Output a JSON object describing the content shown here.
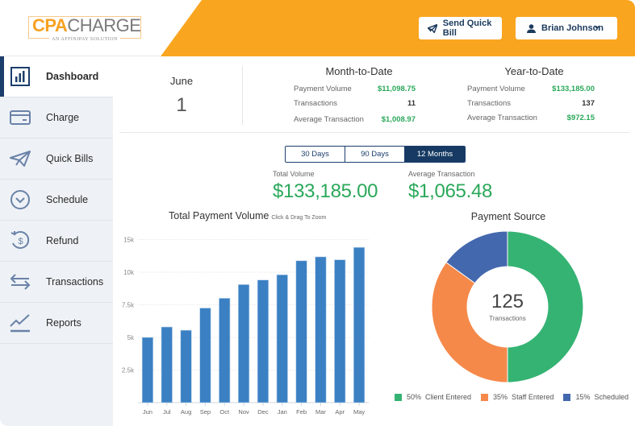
{
  "header": {
    "logo": {
      "cpa": "CPA",
      "charge": "CHARGE",
      "tagline": "AN AFFINIPAY SOLUTION"
    },
    "send_quick_bill_label": "Send Quick Bill",
    "user_name": "Brian Johnson",
    "accent_color": "#f9a520"
  },
  "sidebar": {
    "items": [
      {
        "label": "Dashboard",
        "icon": "bar-chart-icon",
        "active": true
      },
      {
        "label": "Charge",
        "icon": "credit-card-icon"
      },
      {
        "label": "Quick Bills",
        "icon": "paper-plane-icon"
      },
      {
        "label": "Schedule",
        "icon": "clock-chevron-icon"
      },
      {
        "label": "Refund",
        "icon": "refund-dollar-icon"
      },
      {
        "label": "Transactions",
        "icon": "swap-arrows-icon"
      },
      {
        "label": "Reports",
        "icon": "line-chart-icon"
      }
    ]
  },
  "date": {
    "month": "June",
    "day": "1"
  },
  "month_to_date": {
    "title": "Month-to-Date",
    "rows": [
      {
        "label": "Payment Volume",
        "value": "$11,098.75"
      },
      {
        "label": "Transactions",
        "value": "11"
      },
      {
        "label": "Average Transaction",
        "value": "$1,008.97"
      }
    ]
  },
  "year_to_date": {
    "title": "Year-to-Date",
    "rows": [
      {
        "label": "Payment Volume",
        "value": "$133,185.00"
      },
      {
        "label": "Transactions",
        "value": "137"
      },
      {
        "label": "Average Transaction",
        "value": "$972.15"
      }
    ]
  },
  "range_tabs": {
    "options": [
      "30 Days",
      "90 Days",
      "12 Months"
    ],
    "selected": "12 Months"
  },
  "summary": {
    "total_volume_label": "Total Volume",
    "total_volume": "$133,185.00",
    "avg_transaction_label": "Average Transaction",
    "avg_transaction": "$1,065.48"
  },
  "chart_data": [
    {
      "type": "bar",
      "title": "Total Payment Volume",
      "subtitle": "Click & Drag To Zoom",
      "xlabel": "",
      "ylabel": "",
      "categories": [
        "Jun",
        "Jul",
        "Aug",
        "Sep",
        "Oct",
        "Nov",
        "Dec",
        "Jan",
        "Feb",
        "Mar",
        "Apr",
        "May"
      ],
      "values": [
        5000,
        5800,
        5550,
        7250,
        8000,
        9050,
        9400,
        9800,
        11750,
        12350,
        11900,
        13800
      ],
      "y_ticks": [
        {
          "label": "2.5k",
          "value": 2500
        },
        {
          "label": "5k",
          "value": 5000
        },
        {
          "label": "7.5k",
          "value": 7500
        },
        {
          "label": "10k",
          "value": 10000
        },
        {
          "label": "15k",
          "value": 15000
        }
      ],
      "ylim": [
        0,
        15000
      ],
      "grid": true,
      "color": "#3a80c3"
    },
    {
      "type": "pie",
      "title": "Payment Source",
      "center_value": "125",
      "center_label": "Transactions",
      "slices": [
        {
          "name": "Client Entered",
          "percent": 50,
          "label": "50%",
          "color": "#35b373"
        },
        {
          "name": "Staff Entered",
          "percent": 35,
          "label": "35%",
          "color": "#f5894a"
        },
        {
          "name": "Scheduled",
          "percent": 15,
          "label": "15%",
          "color": "#4468ae"
        }
      ],
      "legend": "bottom"
    }
  ]
}
